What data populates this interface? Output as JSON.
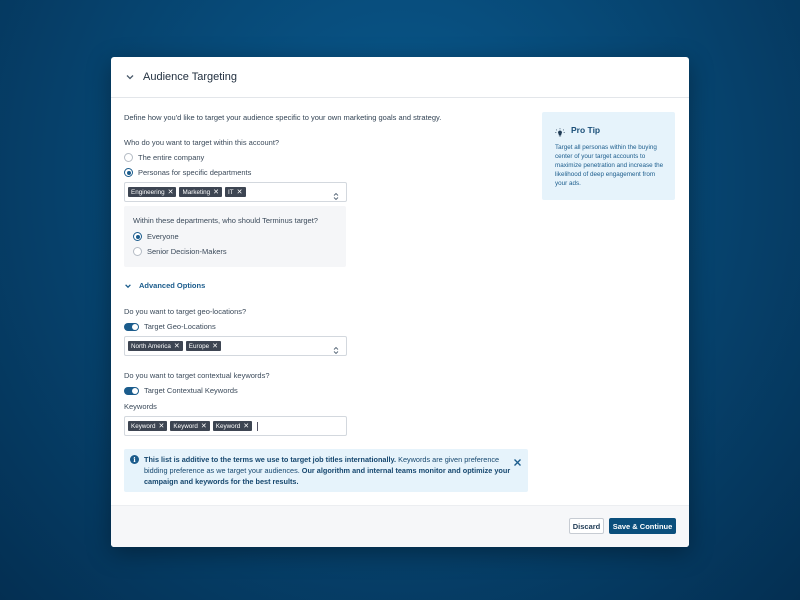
{
  "header": {
    "title": "Audience Targeting"
  },
  "intro": "Define how you'd like to target your audience specific to your own marketing goals and strategy.",
  "targeting": {
    "question": "Who do you want to target within this account?",
    "options": [
      {
        "label": "The entire company",
        "selected": false
      },
      {
        "label": "Personas for specific departments",
        "selected": true
      }
    ],
    "departments": [
      "Engineering",
      "Marketing",
      "IT"
    ],
    "sub_question": "Within these departments, who should Terminus target?",
    "sub_options": [
      {
        "label": "Everyone",
        "selected": true
      },
      {
        "label": "Senior Decision-Makers",
        "selected": false
      }
    ]
  },
  "advanced": {
    "label": "Advanced Options",
    "geo_question": "Do you want to target geo-locations?",
    "geo_toggle_label": "Target Geo-Locations",
    "geo_toggle_on": true,
    "geo_tags": [
      "North America",
      "Europe"
    ],
    "kw_question": "Do you want to target contextual keywords?",
    "kw_toggle_label": "Target Contextual Keywords",
    "kw_toggle_on": true,
    "keywords_label": "Keywords",
    "keyword_tags": [
      "Keyword",
      "Keyword",
      "Keyword"
    ]
  },
  "info": {
    "part1": "This list is additive to the terms we use to target job titles internationally.",
    "part2": " Keywords are given preference bidding preference as we target your audiences. ",
    "part3": "Our algorithm and internal teams monitor and optimize your campaign and keywords for the best results."
  },
  "protip": {
    "title": "Pro Tip",
    "text": "Target all personas within the buying center of your target accounts to maximize penetration and increase the likelihood of deep engagement from your ads."
  },
  "footer": {
    "discard_label": "Discard",
    "save_label": "Save & Continue"
  },
  "colors": {
    "accent": "#0b4f7c",
    "info_bg": "#e6f3fb",
    "tag_bg": "#3d4552"
  }
}
